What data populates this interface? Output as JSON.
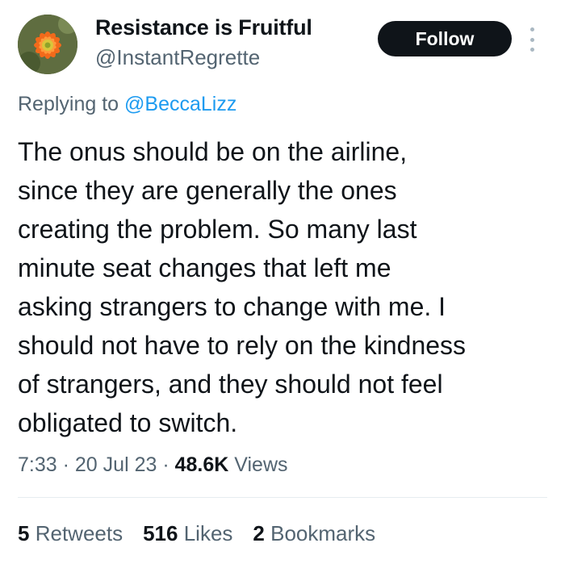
{
  "author": {
    "display_name": "Resistance is Fruitful",
    "handle": "@InstantRegrette",
    "avatar_icon": "cactus-flower-avatar"
  },
  "header": {
    "follow_label": "Follow",
    "more_icon": "more-vertical-icon"
  },
  "reply": {
    "prefix": "Replying to",
    "mention": "@BeccaLizz"
  },
  "tweet": {
    "lines": [
      "The onus should be on the airline,",
      "since they are generally the ones",
      "creating the problem. So many last",
      "minute seat changes that left me",
      "asking strangers to change with me. I",
      "should not have to rely on the kindness",
      "of strangers, and they should not feel",
      "obligated to switch."
    ]
  },
  "meta": {
    "time": "7:33",
    "sep1": "·",
    "date": "20 Jul 23",
    "sep2": "·",
    "views_count": "48.6K",
    "views_label": "Views"
  },
  "stats": {
    "retweets_count": "5",
    "retweets_label": "Retweets",
    "likes_count": "516",
    "likes_label": "Likes",
    "bookmarks_count": "2",
    "bookmarks_label": "Bookmarks"
  },
  "colors": {
    "text": "#0f1419",
    "secondary": "#536471",
    "link": "#1d9bf0",
    "follow_bg": "#0f1419",
    "divider": "#e6ecf0"
  }
}
